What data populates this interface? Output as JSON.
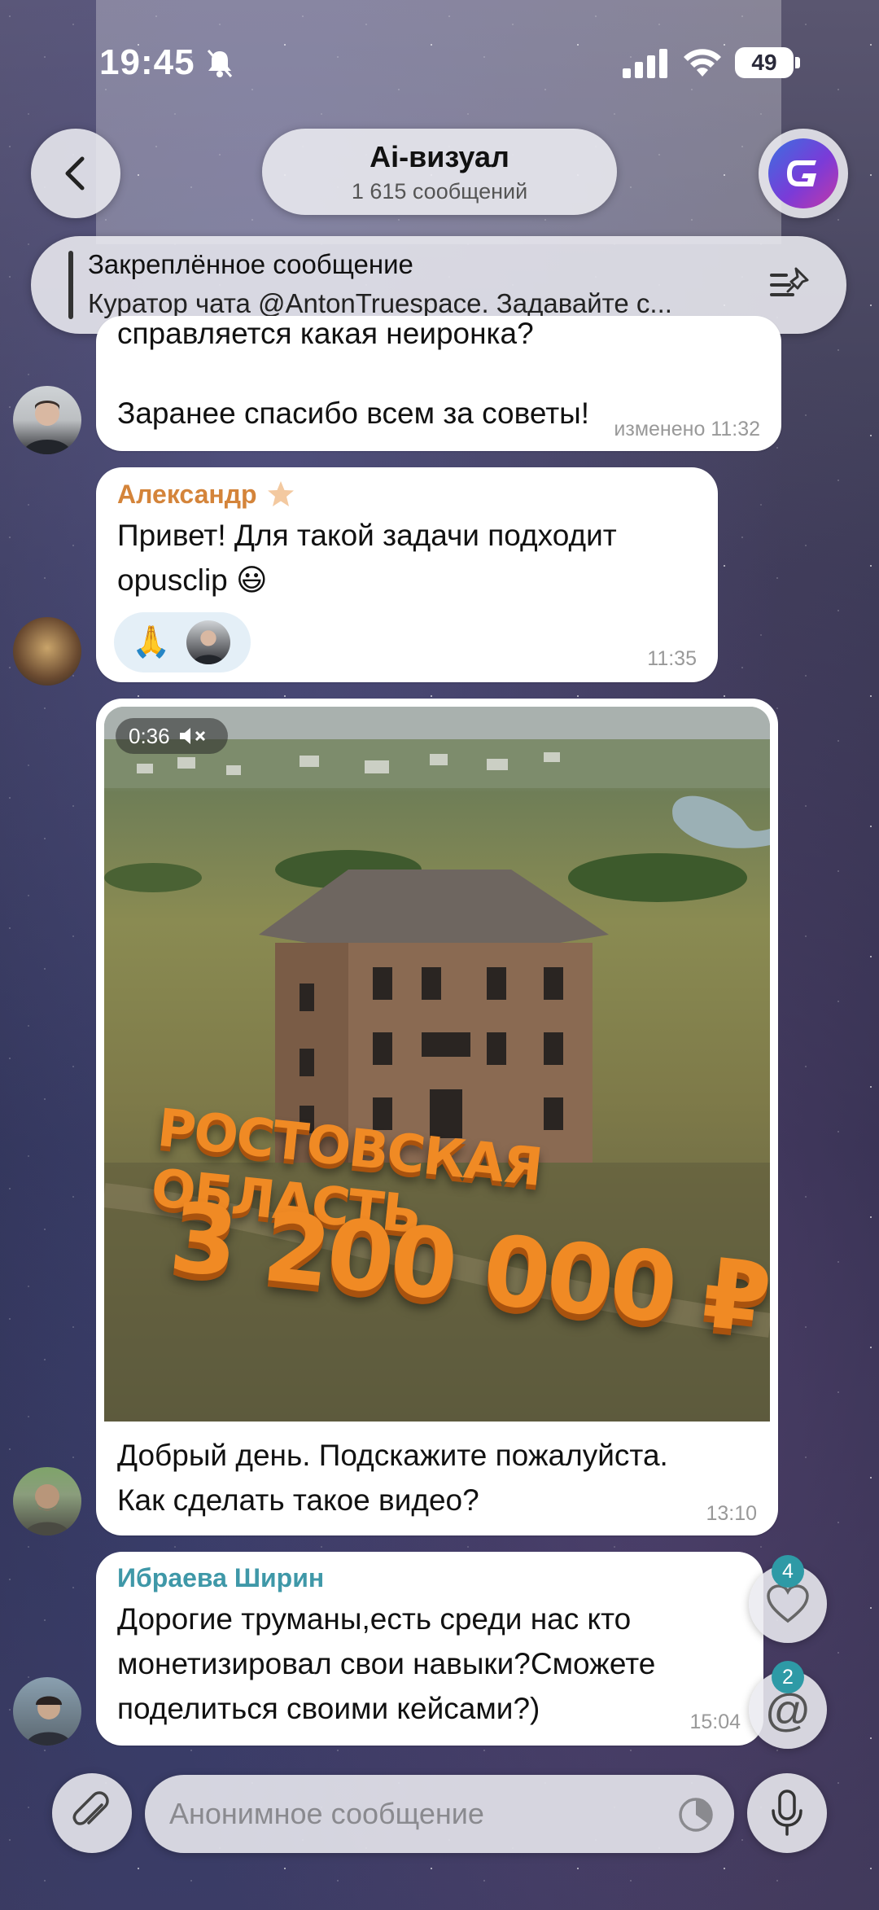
{
  "status_bar": {
    "time": "19:45",
    "battery": "49"
  },
  "header": {
    "title": "Ai-визуал",
    "subtitle": "1 615 сообщений"
  },
  "pinned": {
    "title": "Закреплённое сообщение",
    "text": "Куратор чата @AntonTruespace. Задавайте с..."
  },
  "messages": [
    {
      "partial_line": "справляется какая неиронка?",
      "text": "Заранее спасибо всем за советы!",
      "meta": "изменено 11:32"
    },
    {
      "sender": "Александр",
      "text_line1": "Привет! Для такой задачи подходит",
      "text_line2": "opusclip 😃",
      "reaction": "🙏",
      "time": "11:35"
    },
    {
      "video_duration": "0:36",
      "video_overlay_line1": "РОСТОВСКАЯ ОБЛАСТЬ",
      "video_overlay_line2": "3 200 000 ₽",
      "text_line1": "Добрый день. Подскажите пожалуйста.",
      "text_line2": "Как сделать такое видео?",
      "time": "13:10"
    },
    {
      "sender": "Ибраева Ширин",
      "text_line1": "Дорогие труманы,есть среди нас кто",
      "text_line2": "монетизировал свои навыки?Сможете",
      "text_line3": "поделиться своими кейсами?)",
      "time": "15:04"
    }
  ],
  "side": {
    "reactions_count": "4",
    "mentions_count": "2"
  },
  "composer": {
    "placeholder": "Анонимное сообщение"
  },
  "colors": {
    "sender_orange": "#d4843a",
    "sender_teal": "#3f98a8",
    "badge": "#2e9aa6"
  }
}
